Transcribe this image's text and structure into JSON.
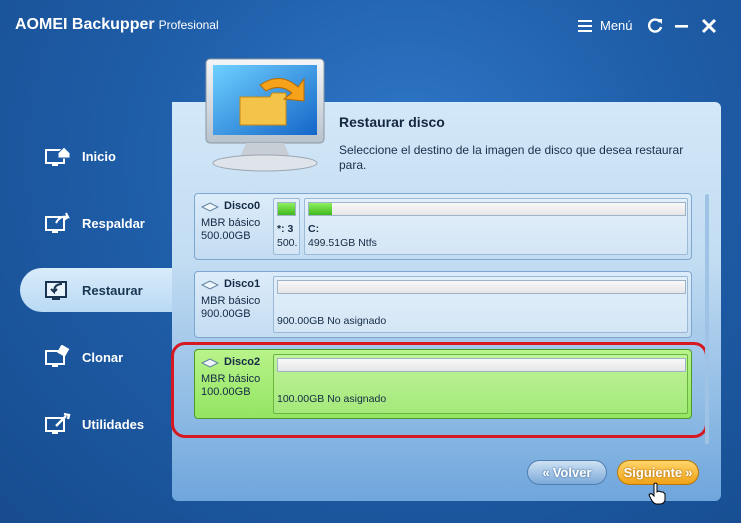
{
  "app": {
    "title": "AOMEI Backupper",
    "edition": "Profesional",
    "menu_label": "Menú"
  },
  "sidebar": {
    "items": [
      {
        "label": "Inicio",
        "icon": "home-icon",
        "active": false
      },
      {
        "label": "Respaldar",
        "icon": "backup-icon",
        "active": false
      },
      {
        "label": "Restaurar",
        "icon": "restore-icon",
        "active": true
      },
      {
        "label": "Clonar",
        "icon": "clone-icon",
        "active": false
      },
      {
        "label": "Utilidades",
        "icon": "tools-icon",
        "active": false
      }
    ]
  },
  "main": {
    "heading": "Restaurar disco",
    "description": "Seleccione el destino de la imagen de disco que desea restaurar para.",
    "disks": [
      {
        "name": "Disco0",
        "type": "MBR básico",
        "size": "500.00GB",
        "selected": false,
        "partitions": [
          {
            "label_top": "*: 3",
            "label_bottom": "500.",
            "fill_percent": 100
          },
          {
            "label_top": "C:",
            "label_bottom": "499.51GB Ntfs",
            "fill_percent": 6
          }
        ]
      },
      {
        "name": "Disco1",
        "type": "MBR básico",
        "size": "900.00GB",
        "selected": false,
        "partitions": [
          {
            "label": "900.00GB No asignado",
            "fill_percent": 0
          }
        ]
      },
      {
        "name": "Disco2",
        "type": "MBR básico",
        "size": "100.00GB",
        "selected": true,
        "partitions": [
          {
            "label": "100.00GB No asignado",
            "fill_percent": 0
          }
        ]
      }
    ]
  },
  "buttons": {
    "back": "Volver",
    "next": "Siguiente"
  },
  "colors": {
    "accent_next": "#f0a218",
    "selected_disk": "#93e562",
    "highlight_border": "#d61820"
  }
}
